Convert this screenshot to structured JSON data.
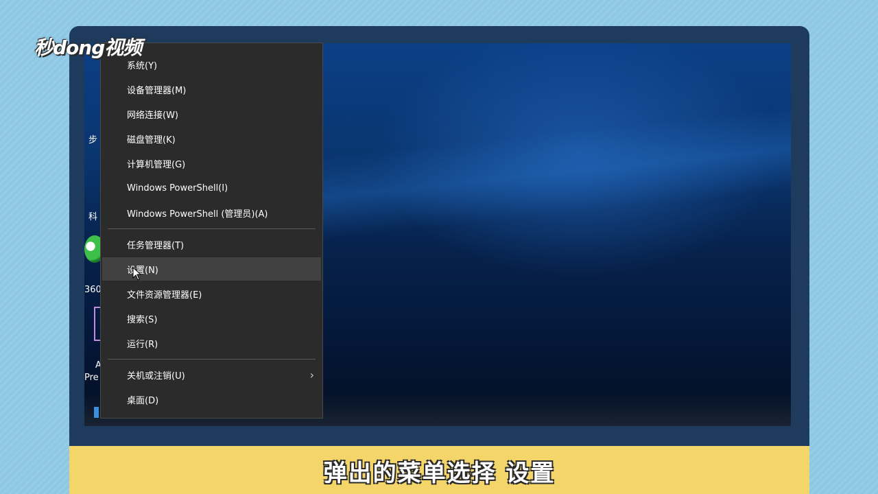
{
  "logo": {
    "text": "秒dong视频"
  },
  "desktop": {
    "labels": [
      "步",
      "科",
      "360",
      "A",
      "Pre"
    ]
  },
  "context_menu": {
    "items": [
      {
        "label": "系统(Y)"
      },
      {
        "label": "设备管理器(M)"
      },
      {
        "label": "网络连接(W)"
      },
      {
        "label": "磁盘管理(K)"
      },
      {
        "label": "计算机管理(G)"
      },
      {
        "label": "Windows PowerShell(I)"
      },
      {
        "label": "Windows PowerShell (管理员)(A)"
      },
      {
        "label": "任务管理器(T)"
      },
      {
        "label": "设置(N)"
      },
      {
        "label": "文件资源管理器(E)"
      },
      {
        "label": "搜索(S)"
      },
      {
        "label": "运行(R)"
      },
      {
        "label": "关机或注销(U)"
      },
      {
        "label": "桌面(D)"
      }
    ],
    "submenu_icon": "chevron-right-icon",
    "highlighted": "设置(N)"
  },
  "caption": {
    "text": "弹出的菜单选择 设置"
  },
  "colors": {
    "background": "#8fc8e4",
    "caption_bar": "#f4d56a",
    "menu_bg": "#2b2b2b",
    "menu_hover": "#414141"
  }
}
